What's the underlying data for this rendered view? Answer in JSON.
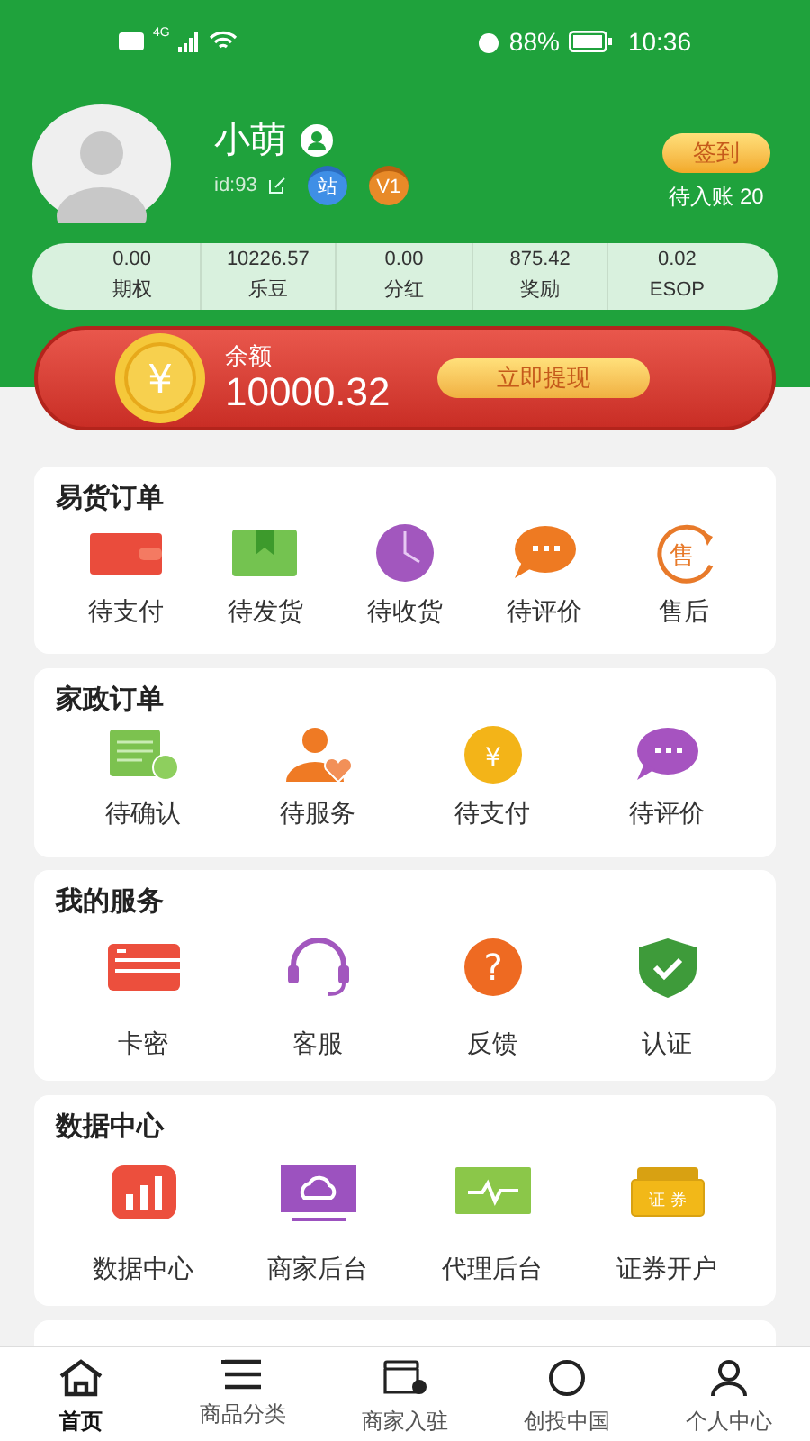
{
  "status_bar": {
    "network": "4G",
    "battery": "88%",
    "time": "10:36"
  },
  "profile": {
    "name": "小萌",
    "user_id": "id:93",
    "badges": [
      "站",
      "V1"
    ],
    "checkin_button": "签到",
    "pending": "待入账 20"
  },
  "stats": [
    {
      "value": "0.00",
      "label": "期权"
    },
    {
      "value": "10226.57",
      "label": "乐豆"
    },
    {
      "value": "0.00",
      "label": "分红"
    },
    {
      "value": "875.42",
      "label": "奖励"
    },
    {
      "value": "0.02",
      "label": "ESOP"
    }
  ],
  "balance": {
    "label": "余额",
    "amount": "10000.32",
    "button": "立即提现"
  },
  "sections": [
    {
      "title": "易货订单",
      "items": [
        "待支付",
        "待发货",
        "待收货",
        "待评价",
        "售后"
      ]
    },
    {
      "title": "家政订单",
      "items": [
        "待确认",
        "待服务",
        "待支付",
        "待评价"
      ]
    },
    {
      "title": "我的服务",
      "items": [
        "卡密",
        "客服",
        "反馈",
        "认证"
      ]
    },
    {
      "title": "数据中心",
      "items": [
        "数据中心",
        "商家后台",
        "代理后台",
        "证券开户"
      ]
    }
  ],
  "icon_texts": {
    "after_sales": "售",
    "yuan": "¥",
    "question": "?",
    "securities": "证 券",
    "coin": "¥"
  },
  "bottom_nav": [
    {
      "label": "首页",
      "selected": true
    },
    {
      "label": "商品分类",
      "selected": false
    },
    {
      "label": "商家入驻",
      "selected": false
    },
    {
      "label": "创投中国",
      "selected": false
    },
    {
      "label": "个人中心",
      "selected": false
    }
  ]
}
